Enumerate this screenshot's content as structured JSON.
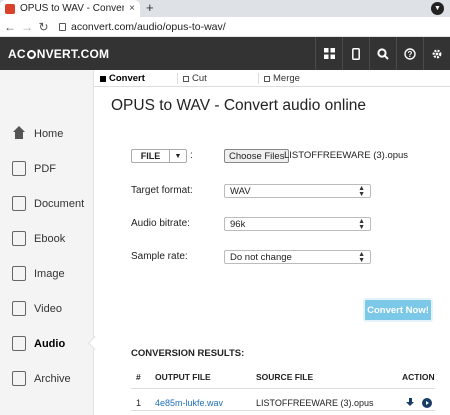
{
  "browser": {
    "tab_title": "OPUS to WAV - Convert audio online",
    "tab_close": "×",
    "new_tab": "+",
    "url": "aconvert.com/audio/opus-to-wav/",
    "window_menu_icon": "chevron-down-icon"
  },
  "site": {
    "logo_prefix": "AC",
    "logo_suffix": "NVERT.COM",
    "header_icons": [
      "grid-icon",
      "mobile-icon",
      "search-icon",
      "help-icon",
      "gear-icon"
    ]
  },
  "sidebar": {
    "items": [
      {
        "label": "Home",
        "icon": "home-icon"
      },
      {
        "label": "PDF",
        "icon": "pdf-icon"
      },
      {
        "label": "Document",
        "icon": "document-icon"
      },
      {
        "label": "Ebook",
        "icon": "ebook-icon"
      },
      {
        "label": "Image",
        "icon": "image-icon"
      },
      {
        "label": "Video",
        "icon": "video-icon"
      },
      {
        "label": "Audio",
        "icon": "audio-icon"
      },
      {
        "label": "Archive",
        "icon": "archive-icon"
      }
    ],
    "active": "Audio"
  },
  "subtabs": [
    {
      "label": "Convert",
      "active": true
    },
    {
      "label": "Cut",
      "active": false
    },
    {
      "label": "Merge",
      "active": false
    }
  ],
  "main": {
    "title": "OPUS to WAV - Convert audio online",
    "file_button": "FILE",
    "file_separator": ":",
    "choose_files": "Choose Files",
    "chosen_file": "LISTOFFREEWARE (3).opus",
    "fields": [
      {
        "label": "Target format:",
        "value": "WAV"
      },
      {
        "label": "Audio bitrate:",
        "value": "96k"
      },
      {
        "label": "Sample rate:",
        "value": "Do not change"
      }
    ],
    "convert_button": "Convert Now!"
  },
  "results": {
    "heading": "CONVERSION RESULTS:",
    "columns": [
      "#",
      "OUTPUT FILE",
      "SOURCE FILE",
      "ACTION"
    ],
    "rows": [
      {
        "num": "1",
        "output": "4e85m-lukfe.wav",
        "source": "LISTOFFREEWARE (3).opus"
      }
    ]
  },
  "colors": {
    "header_bg": "#333333",
    "convert_button": "#7cc8e8",
    "link": "#1e6fb8"
  }
}
